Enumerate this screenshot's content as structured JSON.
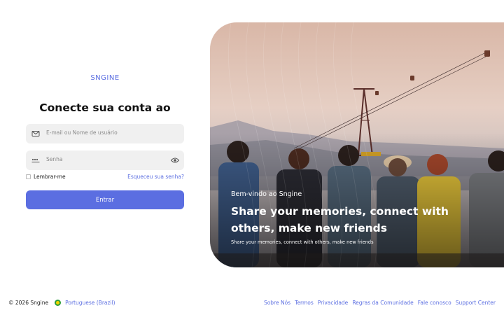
{
  "brand": {
    "logo_text": "SNGINE",
    "accent_color": "#5b6ee1"
  },
  "login": {
    "title": "Conecte sua conta ao",
    "email_placeholder": "E-mail ou Nome de usuário",
    "password_placeholder": "Senha",
    "remember_label": "Lembrar-me",
    "forgot_link": "Esqueceu sua senha?",
    "submit_label": "Entrar"
  },
  "hero": {
    "welcome": "Bem-vindo ao Sngine",
    "headline": "Share your memories, connect with others, make new friends",
    "subtext": "Share your memories, connect with others, make new friends"
  },
  "footer": {
    "copyright": "© 2026 Sngine",
    "language": "Portuguese (Brazil)",
    "links": [
      "Sobre Nós",
      "Termos",
      "Privacidade",
      "Regras da Comunidade",
      "Fale conosco",
      "Support Center"
    ]
  },
  "icons": {
    "email": "envelope-icon",
    "password": "password-dots-icon",
    "show_password": "eye-icon",
    "language": "brazil-flag-icon"
  }
}
